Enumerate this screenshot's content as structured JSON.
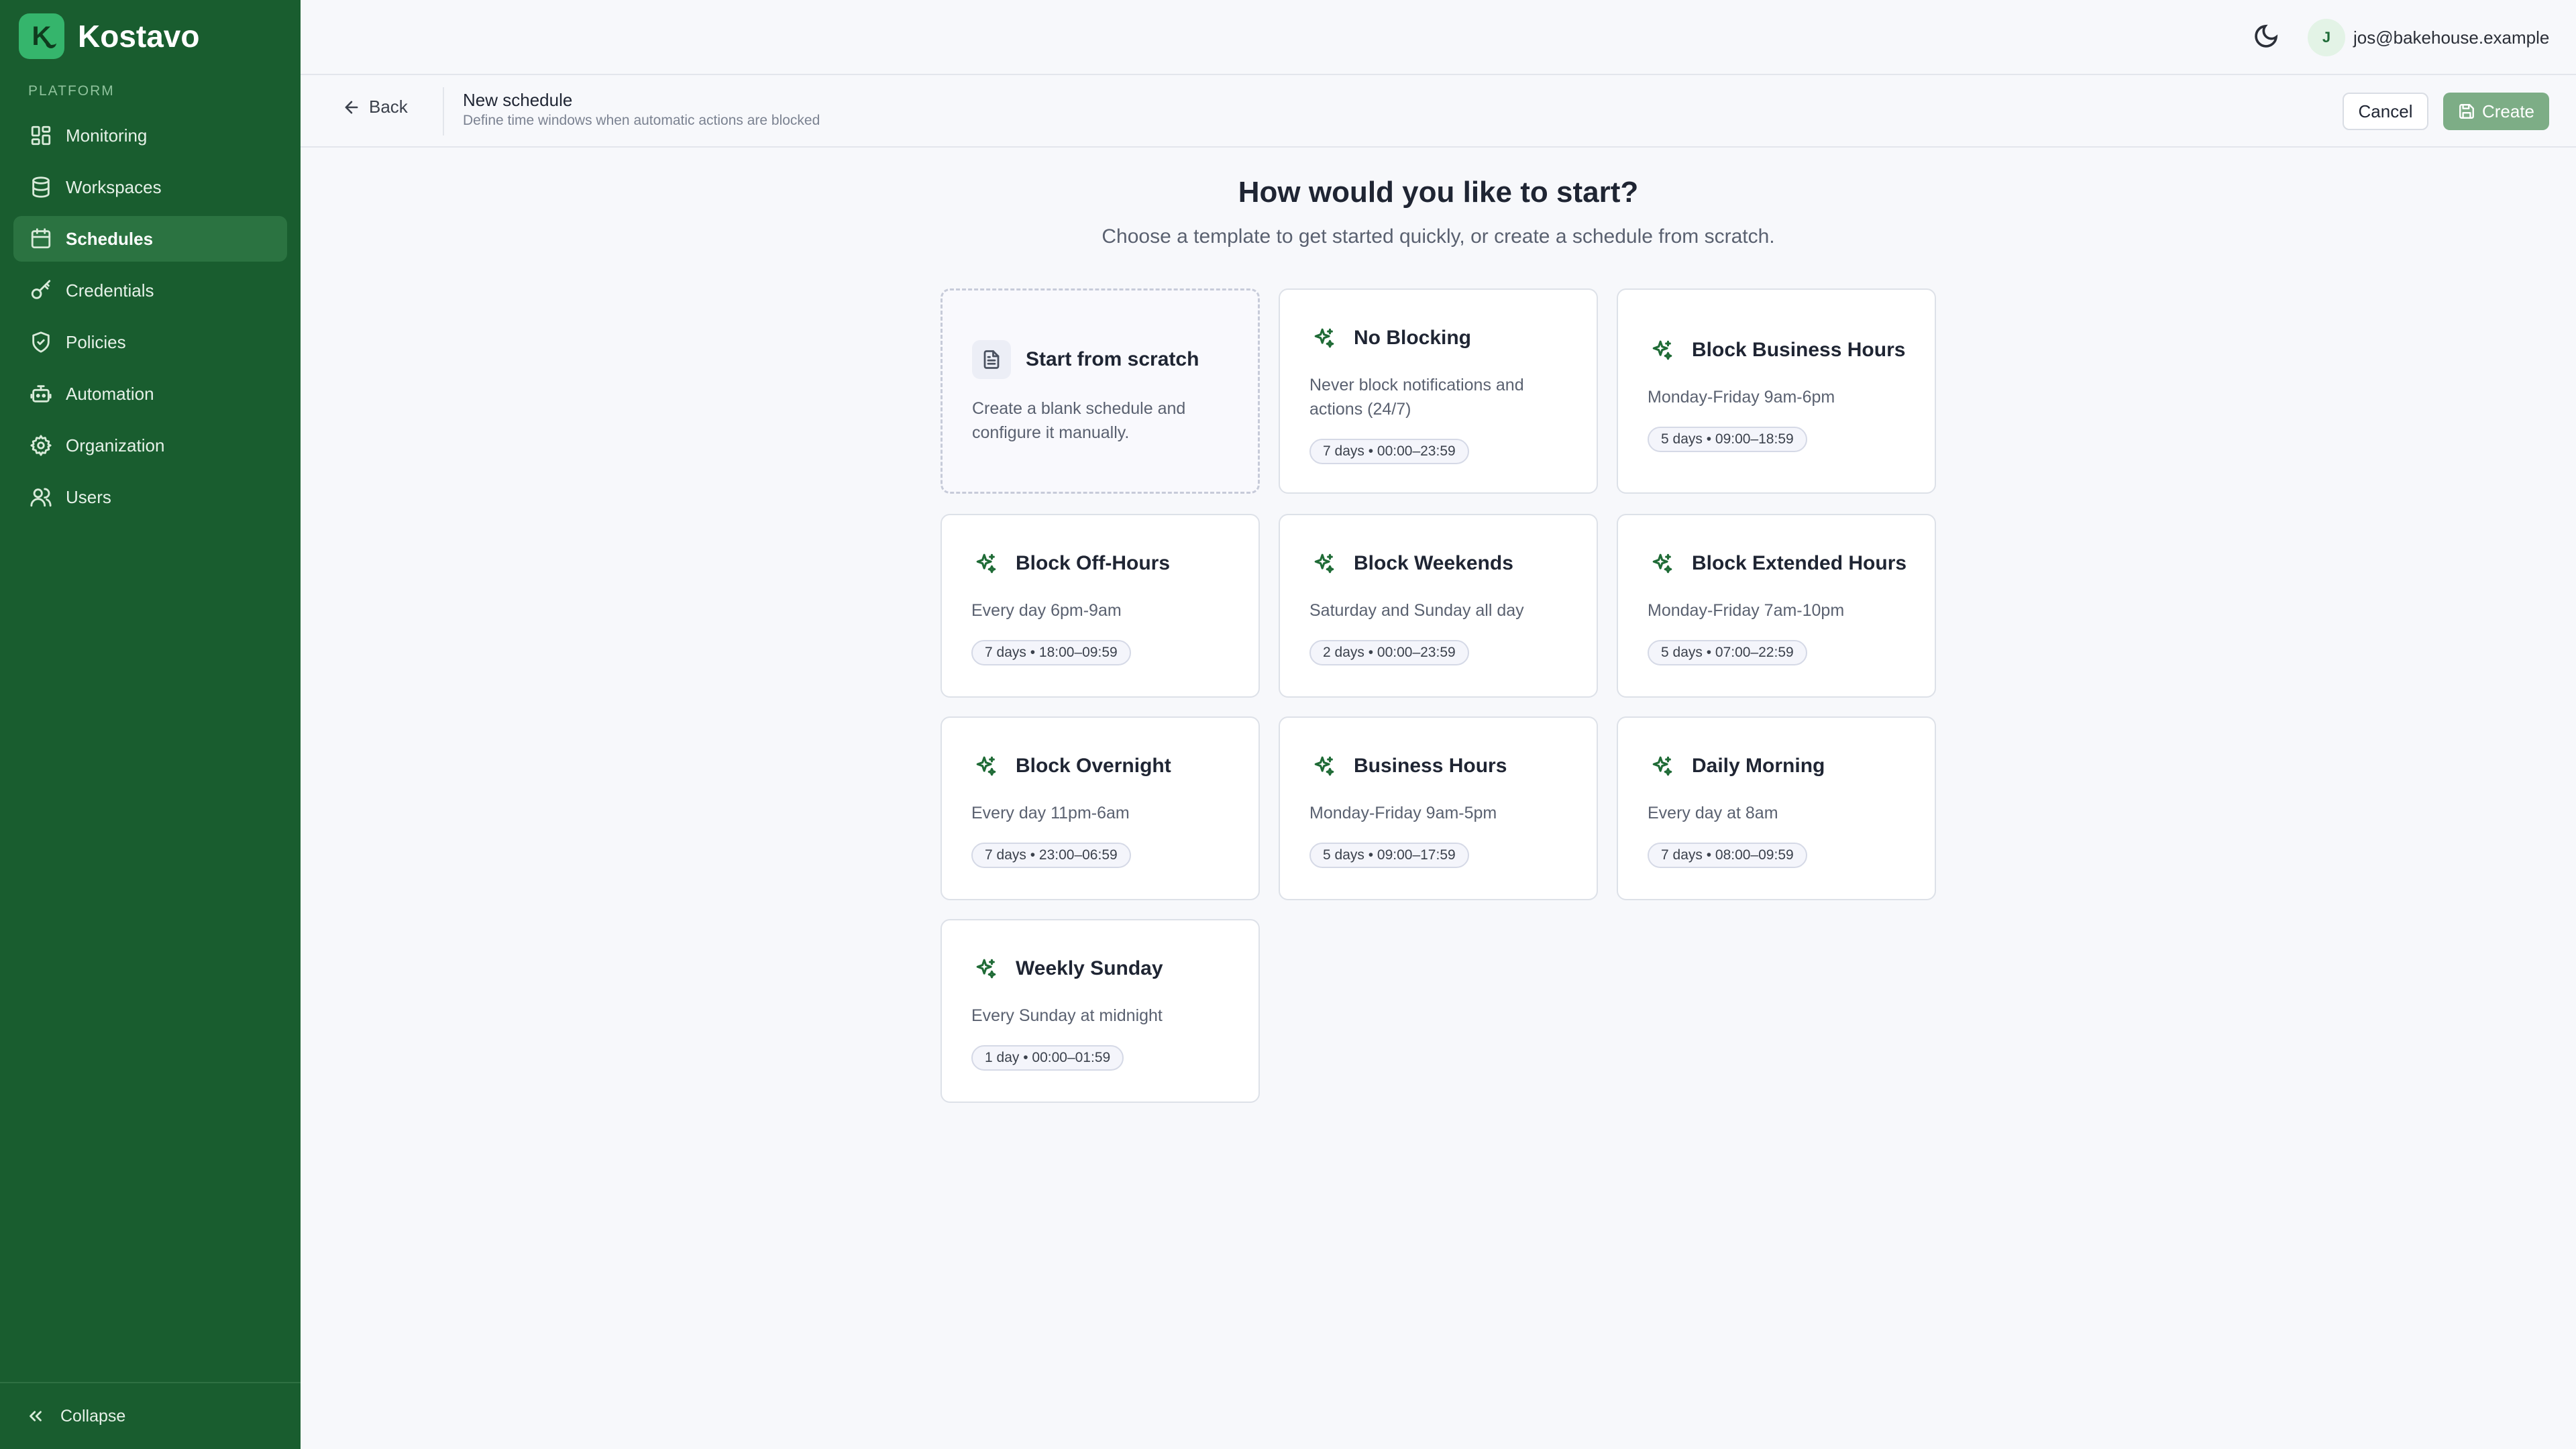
{
  "brand": {
    "logo_letter": "K",
    "name": "Kostavo"
  },
  "sidebar": {
    "section_label": "PLATFORM",
    "items": [
      {
        "label": "Monitoring",
        "icon": "dashboard-icon"
      },
      {
        "label": "Workspaces",
        "icon": "database-icon"
      },
      {
        "label": "Schedules",
        "icon": "calendar-icon",
        "active": true
      },
      {
        "label": "Credentials",
        "icon": "key-icon"
      },
      {
        "label": "Policies",
        "icon": "shield-icon"
      },
      {
        "label": "Automation",
        "icon": "robot-icon"
      },
      {
        "label": "Organization",
        "icon": "gear-icon"
      },
      {
        "label": "Users",
        "icon": "users-icon"
      }
    ],
    "collapse_label": "Collapse"
  },
  "topbar": {
    "user_initial": "J",
    "user_email": "jos@bakehouse.example"
  },
  "header": {
    "back_label": "Back",
    "title": "New schedule",
    "subtitle": "Define time windows when automatic actions are blocked",
    "cancel_label": "Cancel",
    "create_label": "Create"
  },
  "main": {
    "title": "How would you like to start?",
    "subtitle": "Choose a template to get started quickly, or create a schedule from scratch."
  },
  "templates": [
    {
      "title": "Start from scratch",
      "desc": "Create a blank schedule and configure it manually.",
      "pill": ""
    },
    {
      "title": "No Blocking",
      "desc": "Never block notifications and actions (24/7)",
      "pill": "7 days • 00:00–23:59"
    },
    {
      "title": "Block Business Hours",
      "desc": "Monday-Friday 9am-6pm",
      "pill": "5 days • 09:00–18:59"
    },
    {
      "title": "Block Off-Hours",
      "desc": "Every day 6pm-9am",
      "pill": "7 days • 18:00–09:59"
    },
    {
      "title": "Block Weekends",
      "desc": "Saturday and Sunday all day",
      "pill": "2 days • 00:00–23:59"
    },
    {
      "title": "Block Extended Hours",
      "desc": "Monday-Friday 7am-10pm",
      "pill": "5 days • 07:00–22:59"
    },
    {
      "title": "Block Overnight",
      "desc": "Every day 11pm-6am",
      "pill": "7 days • 23:00–06:59"
    },
    {
      "title": "Business Hours",
      "desc": "Monday-Friday 9am-5pm",
      "pill": "5 days • 09:00–17:59"
    },
    {
      "title": "Daily Morning",
      "desc": "Every day at 8am",
      "pill": "7 days • 08:00–09:59"
    },
    {
      "title": "Weekly Sunday",
      "desc": "Every Sunday at midnight",
      "pill": "1 day • 00:00–01:59"
    }
  ],
  "colors": {
    "sidebar_bg": "#195d2f",
    "accent": "#35b56c",
    "create_button": "#7dad86"
  }
}
